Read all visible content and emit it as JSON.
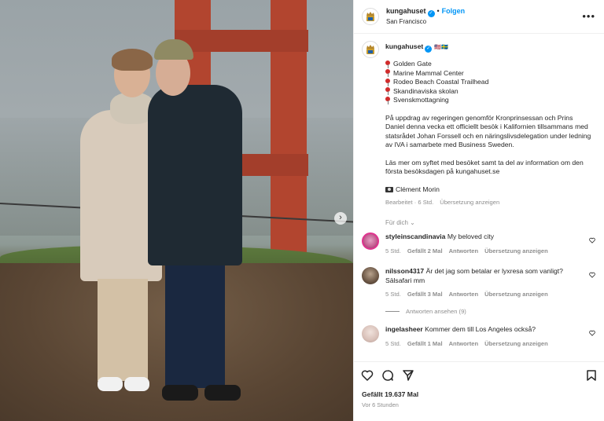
{
  "post": {
    "username": "kungahuset",
    "location": "San Francisco",
    "follow_label": "Folgen",
    "flags": "🇺🇸🇸🇪"
  },
  "caption": {
    "places": [
      "Golden Gate",
      "Marine Mammal Center",
      "Rodeo Beach Coastal Trailhead",
      "Skandinaviska skolan",
      "Svenskmottagning"
    ],
    "paragraph1": "På uppdrag av regeringen genomför Kronprinsessan och Prins Daniel denna vecka ett officiellt besök i Kalifornien tillsammans med statsrådet Johan Forssell och en näringslivsdelegation under ledning av IVA i samarbete med Business Sweden.",
    "paragraph2": "Läs mer om syftet med besöket samt ta del av information om den första besöksdagen på kungahuset.se",
    "photo_credit": "Clément Morin",
    "edited": "Bearbeitet · 6 Std.",
    "see_translation": "Übersetzung anzeigen"
  },
  "for_you": "Für dich",
  "comments": [
    {
      "username": "styleinscandinavia",
      "text": "My beloved city",
      "age": "5 Std.",
      "likes": "Gefällt 2 Mal",
      "reply": "Antworten",
      "translate": "Übersetzung anzeigen"
    },
    {
      "username": "nilsson4317",
      "text": "Är det jag som betalar er lyxresa som vanligt? Sälsafari mm",
      "age": "5 Std.",
      "likes": "Gefällt 3 Mal",
      "reply": "Antworten",
      "translate": "Übersetzung anzeigen"
    },
    {
      "username": "ingelasheer",
      "text": "Kommer dem till Los Angeles också?",
      "age": "5 Std.",
      "likes": "Gefällt 1 Mal",
      "reply": "Antworten",
      "translate": "Übersetzung anzeigen"
    }
  ],
  "view_replies": "Antworten ansehen (9)",
  "likes_total": "Gefällt 19.637 Mal",
  "posted_ago": "Vor 6 Stunden",
  "icons": {
    "verified": "verified-badge-icon",
    "more": "more-options-icon",
    "like": "heart-icon",
    "comment": "comment-icon",
    "share": "send-icon",
    "save": "bookmark-icon",
    "next": "chevron-right-icon"
  },
  "colors": {
    "accent": "#0095f6",
    "muted": "#8e8e8e",
    "text": "#262626"
  }
}
